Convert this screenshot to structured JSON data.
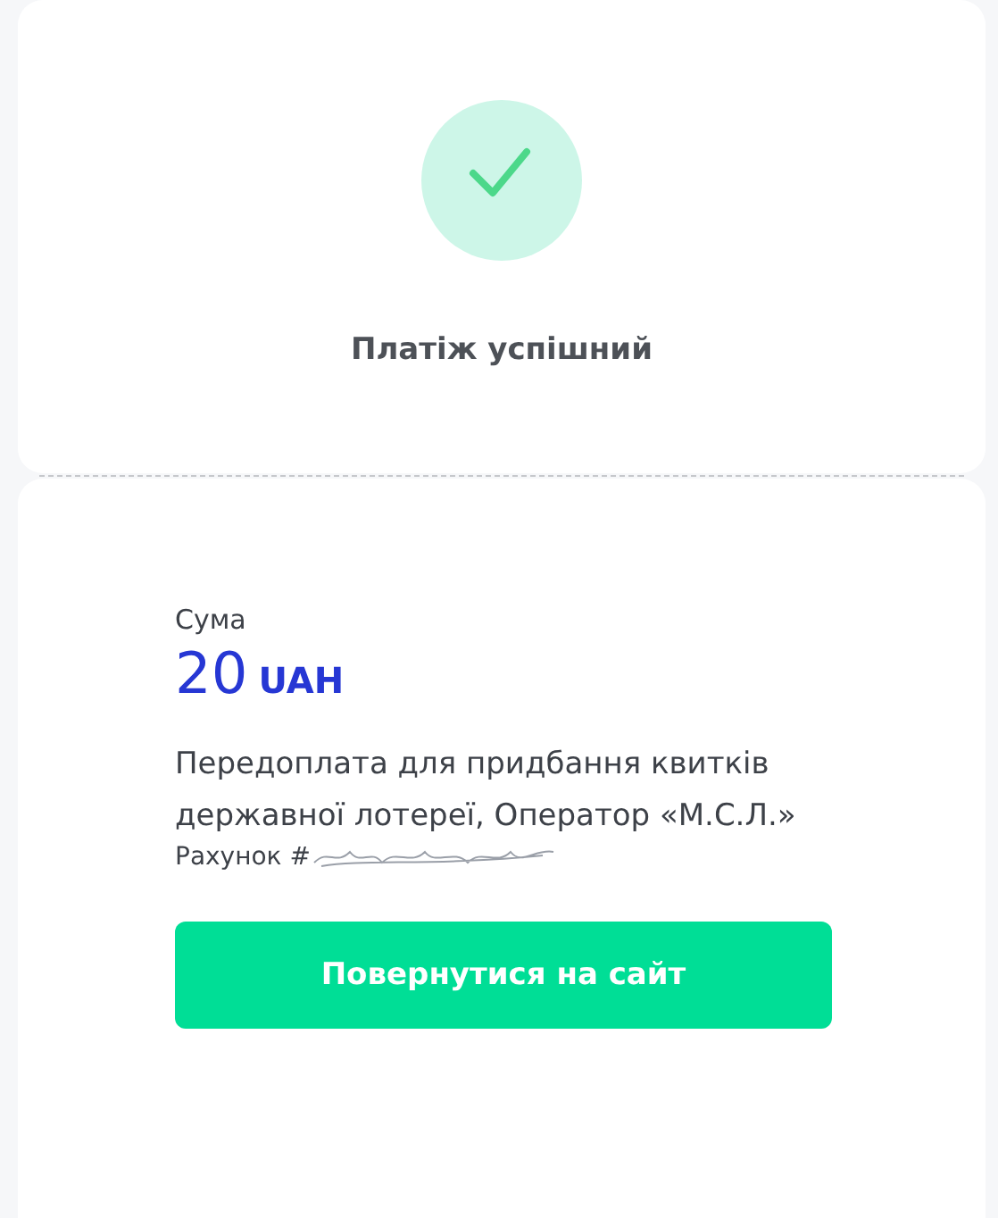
{
  "status": {
    "kind": "success",
    "title": "Платіж успішний"
  },
  "payment": {
    "amount_label": "Сума",
    "amount": "20",
    "currency": "UAH",
    "description": "Передоплата для придбання квитків державної лотереї, Оператор «М.С.Л.»",
    "account_label": "Рахунок #"
  },
  "button": {
    "label": "Повернутися на сайт"
  }
}
